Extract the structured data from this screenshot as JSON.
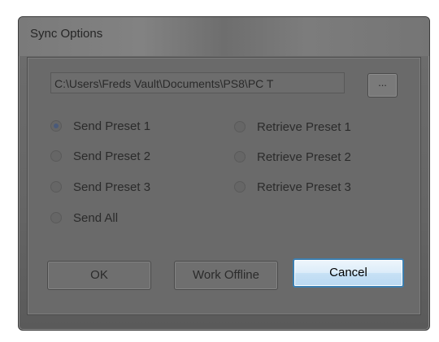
{
  "window": {
    "title": "Sync Options"
  },
  "path": {
    "value": "C:\\Users\\Freds Vault\\Documents\\PS8\\PC T",
    "browse_label": "..."
  },
  "radios": [
    {
      "label": "Send Preset 1",
      "checked": true
    },
    {
      "label": "Send Preset 2",
      "checked": false
    },
    {
      "label": "Send Preset 3",
      "checked": false
    },
    {
      "label": "Send All",
      "checked": false
    },
    {
      "label": "Retrieve Preset 1",
      "checked": false
    },
    {
      "label": "Retrieve Preset 2",
      "checked": false
    },
    {
      "label": "Retrieve Preset 3",
      "checked": false
    }
  ],
  "buttons": {
    "ok": "OK",
    "work_offline": "Work Offline",
    "cancel": "Cancel"
  },
  "colors": {
    "dimmed_overlay": "#6a6a6a",
    "default_button_border": "#3c7fb1",
    "default_button_fill": "#dcecf9"
  }
}
